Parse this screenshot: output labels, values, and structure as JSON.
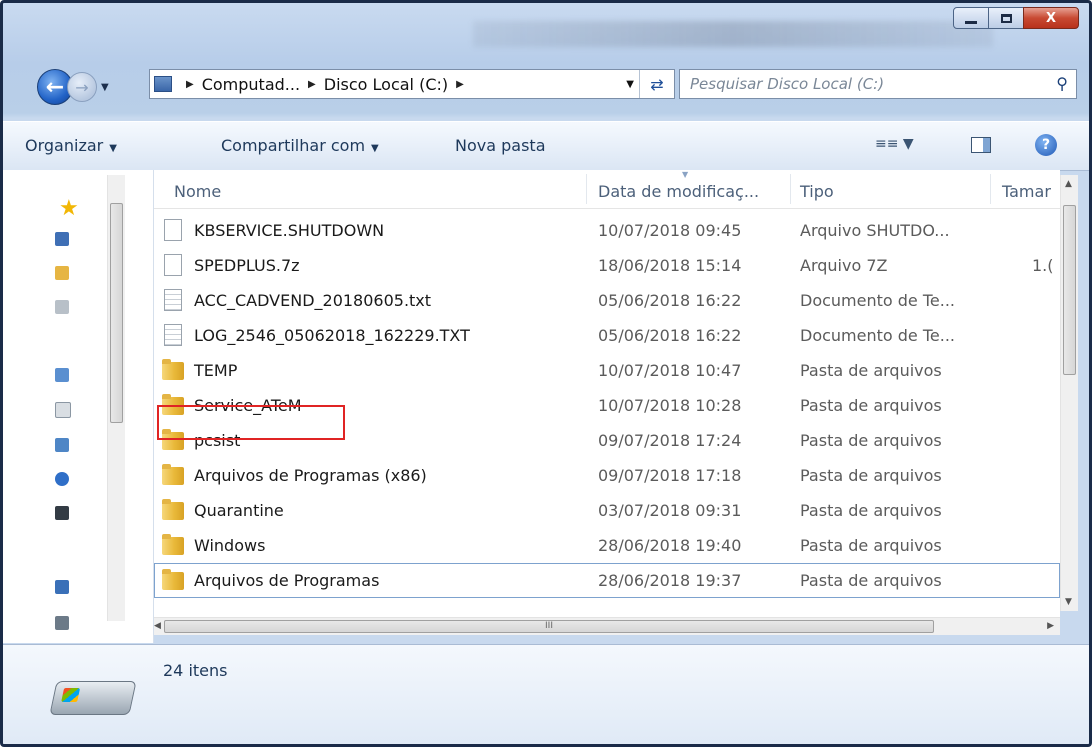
{
  "window": {
    "minimize_label": "",
    "close_label": "X"
  },
  "address": {
    "crumbs": [
      "Computad...",
      "Disco Local (C:)"
    ]
  },
  "search": {
    "placeholder": "Pesquisar Disco Local (C:)"
  },
  "toolbar": {
    "organize": "Organizar",
    "share": "Compartilhar com",
    "new_folder": "Nova pasta",
    "view_icon": "view-options-icon",
    "preview_icon": "preview-pane-icon",
    "help_icon": "help-icon"
  },
  "columns": {
    "name": "Nome",
    "date": "Data de modificaç...",
    "type": "Tipo",
    "size": "Tamar"
  },
  "files": [
    {
      "name": "KBSERVICE.SHUTDOWN",
      "date": "10/07/2018 09:45",
      "type": "Arquivo SHUTDO...",
      "size": "",
      "icon": "file-icon"
    },
    {
      "name": "SPEDPLUS.7z",
      "date": "18/06/2018 15:14",
      "type": "Arquivo 7Z",
      "size": "1.(",
      "icon": "file-icon"
    },
    {
      "name": "ACC_CADVEND_20180605.txt",
      "date": "05/06/2018 16:22",
      "type": "Documento de Te...",
      "size": "",
      "icon": "text-file-icon"
    },
    {
      "name": "LOG_2546_05062018_162229.TXT",
      "date": "05/06/2018 16:22",
      "type": "Documento de Te...",
      "size": "",
      "icon": "text-file-icon"
    },
    {
      "name": "TEMP",
      "date": "10/07/2018 10:47",
      "type": "Pasta de arquivos",
      "size": "",
      "icon": "folder-icon"
    },
    {
      "name": "Service_ATeM",
      "date": "10/07/2018 10:28",
      "type": "Pasta de arquivos",
      "size": "",
      "icon": "folder-icon"
    },
    {
      "name": "pcsist",
      "date": "09/07/2018 17:24",
      "type": "Pasta de arquivos",
      "size": "",
      "icon": "folder-icon"
    },
    {
      "name": "Arquivos de Programas (x86)",
      "date": "09/07/2018 17:18",
      "type": "Pasta de arquivos",
      "size": "",
      "icon": "folder-icon"
    },
    {
      "name": "Quarantine",
      "date": "03/07/2018 09:31",
      "type": "Pasta de arquivos",
      "size": "",
      "icon": "folder-icon"
    },
    {
      "name": "Windows",
      "date": "28/06/2018 19:40",
      "type": "Pasta de arquivos",
      "size": "",
      "icon": "folder-icon"
    },
    {
      "name": "Arquivos de Programas",
      "date": "28/06/2018 19:37",
      "type": "Pasta de arquivos",
      "size": "",
      "icon": "folder-icon"
    }
  ],
  "status": {
    "count": "24 itens"
  },
  "colors": {
    "highlight": "#e02424",
    "accent": "#1e395b"
  }
}
